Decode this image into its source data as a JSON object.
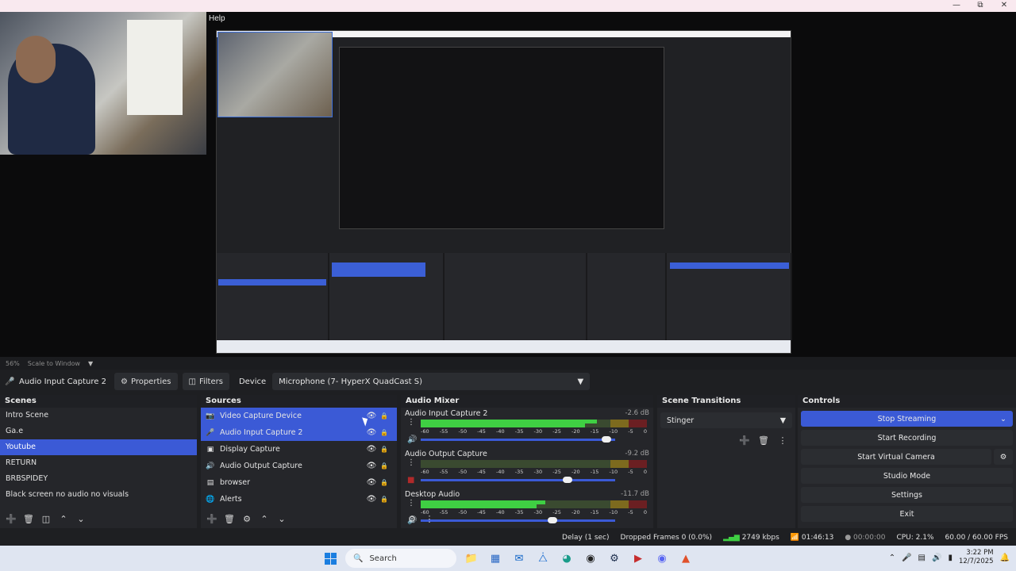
{
  "preview": {
    "inner_menu": "Help",
    "scale_zoom": "56%",
    "scale_mode": "Scale to Window"
  },
  "source_toolbar": {
    "source_name": "Audio Input Capture 2",
    "properties_label": "Properties",
    "filters_label": "Filters",
    "device_label": "Device",
    "device_value": "Microphone (7- HyperX QuadCast S)"
  },
  "scenes": {
    "title": "Scenes",
    "items": [
      {
        "label": "Intro Scene"
      },
      {
        "label": "Ga.e"
      },
      {
        "label": "Youtube"
      },
      {
        "label": "RETURN"
      },
      {
        "label": "BRBSPIDEY"
      },
      {
        "label": "Black screen no audio no visuals"
      }
    ],
    "active_index": 2
  },
  "sources": {
    "title": "Sources",
    "items": [
      {
        "label": "Video Capture Device",
        "icon": "camera-icon"
      },
      {
        "label": "Audio Input Capture 2",
        "icon": "microphone-icon"
      },
      {
        "label": "Display Capture",
        "icon": "monitor-icon"
      },
      {
        "label": "Audio Output Capture",
        "icon": "speaker-icon"
      },
      {
        "label": "browser",
        "icon": "browser-icon"
      },
      {
        "label": "Alerts",
        "icon": "globe-icon"
      }
    ]
  },
  "mixer": {
    "title": "Audio Mixer",
    "ticks": [
      "-60",
      "-55",
      "-50",
      "-45",
      "-40",
      "-35",
      "-30",
      "-25",
      "-20",
      "-15",
      "-10",
      "-5",
      "0"
    ],
    "channels": [
      {
        "name": "Audio Input Capture 2",
        "db": "-2.6 dB",
        "level": 0.78,
        "volume": 0.98,
        "muted": false
      },
      {
        "name": "Audio Output Capture",
        "db": "-9.2 dB",
        "level": 0.0,
        "volume": 0.78,
        "muted": true
      },
      {
        "name": "Desktop Audio",
        "db": "-11.7 dB",
        "level": 0.55,
        "volume": 0.7,
        "muted": false
      }
    ]
  },
  "transitions": {
    "title": "Scene Transitions",
    "selected": "Stinger"
  },
  "controls": {
    "title": "Controls",
    "stop_streaming": "Stop Streaming",
    "start_recording": "Start Recording",
    "start_virtual_camera": "Start Virtual Camera",
    "studio_mode": "Studio Mode",
    "settings": "Settings",
    "exit": "Exit"
  },
  "status": {
    "delay": "Delay (1 sec)",
    "dropped_frames": "Dropped Frames 0 (0.0%)",
    "bitrate": "2749 kbps",
    "stream_time": "01:46:13",
    "rec_time": "00:00:00",
    "cpu": "CPU: 2.1%",
    "fps": "60.00 / 60.00 FPS"
  },
  "taskbar": {
    "search_placeholder": "Search",
    "time": "3:22 PM",
    "date": "12/7/2025"
  },
  "colors": {
    "accent": "#3b5ad6",
    "meter_green": "#3fcf43",
    "meter_yellow": "#7d6a1e",
    "meter_red": "#6b1f22"
  }
}
